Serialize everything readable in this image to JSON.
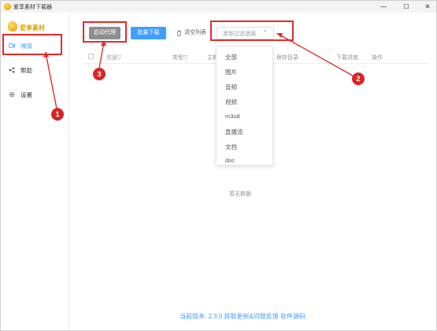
{
  "window": {
    "title": "爱享素材下载器",
    "minimize": "—",
    "maximize": "☐",
    "close": "✕"
  },
  "sidebar": {
    "logo_text": "爱享素材",
    "items": [
      {
        "label": "嗅探",
        "icon": "video-icon",
        "active": true
      },
      {
        "label": "帮助",
        "icon": "share-icon",
        "active": false
      },
      {
        "label": "设置",
        "icon": "gear-icon",
        "active": false
      }
    ]
  },
  "toolbar": {
    "start_proxy": "启动代理",
    "batch_download": "批量下载",
    "clear_list": "清空列表",
    "type_select_placeholder": "类型过滤选择",
    "chevron": "⌃"
  },
  "table": {
    "headers": [
      "信息▽",
      "类型▽",
      "主机",
      "保存目录",
      "下载进度",
      "操作"
    ],
    "empty_text": "暂无数据"
  },
  "dropdown": {
    "options": [
      "全部",
      "图片",
      "音频",
      "视频",
      "m3u8",
      "直播流",
      "文档",
      "doc"
    ]
  },
  "footer": {
    "text": "当前版本: 2.3.0  获取更新&问题反馈  软件源码"
  },
  "annotations": [
    "1",
    "2",
    "3"
  ],
  "colors": {
    "accent": "#409eff",
    "annotation": "#e52b2b",
    "gray_button": "#8e8e8e"
  }
}
